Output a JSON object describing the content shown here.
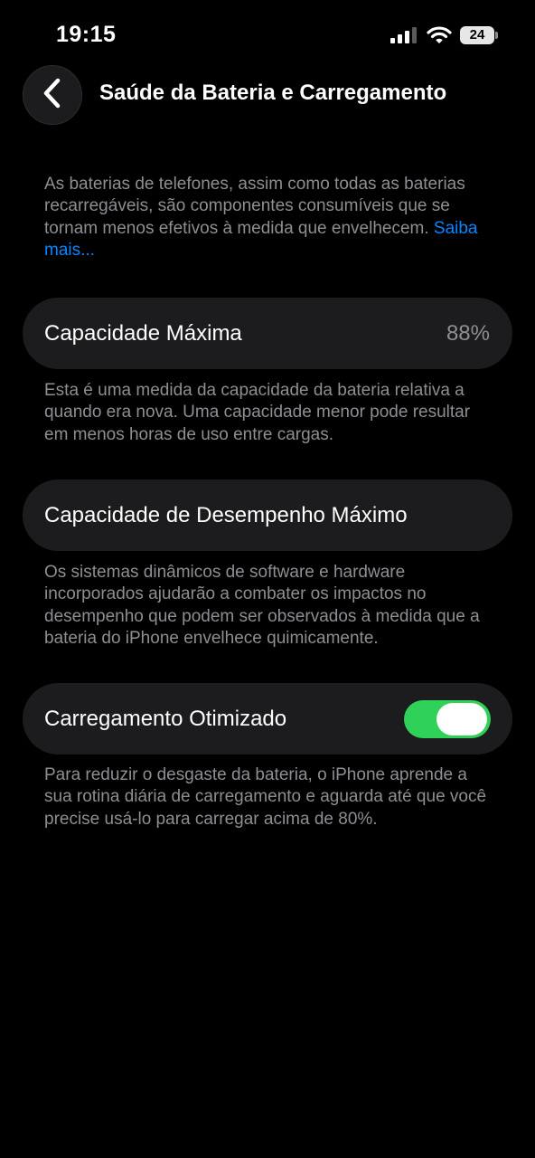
{
  "status_bar": {
    "time": "19:15",
    "battery_level": "24",
    "icons": [
      "cellular-signal-icon",
      "wifi-icon",
      "battery-icon"
    ]
  },
  "header": {
    "title": "Saúde da Bateria e Carregamento",
    "back_icon": "chevron-left-icon"
  },
  "intro": {
    "text": "As baterias de telefones, assim como todas as baterias recarregáveis, são componentes consumíveis que se tornam menos efetivos à medida que envelhecem. ",
    "link": "Saiba mais..."
  },
  "max_capacity": {
    "label": "Capacidade Máxima",
    "value": "88%",
    "footnote": "Esta é uma medida da capacidade da bateria relativa a quando era nova. Uma capacidade menor pode resultar em menos horas de uso entre cargas."
  },
  "peak_performance": {
    "label": "Capacidade de Desempenho Máximo",
    "footnote": "Os sistemas dinâmicos de software e hardware incorporados ajudarão a combater os impactos no desempenho que podem ser observados à medida que a bateria do iPhone envelhece quimicamente."
  },
  "optimized_charging": {
    "label": "Carregamento Otimizado",
    "enabled": true,
    "footnote": "Para reduzir o desgaste da bateria, o iPhone aprende a sua rotina diária de carregamento e aguarda até que você precise usá-lo para carregar acima de 80%."
  },
  "colors": {
    "background": "#000000",
    "card": "#1c1c1e",
    "secondary_text": "#8e8e93",
    "link": "#0a84ff",
    "toggle_on": "#30d158"
  }
}
